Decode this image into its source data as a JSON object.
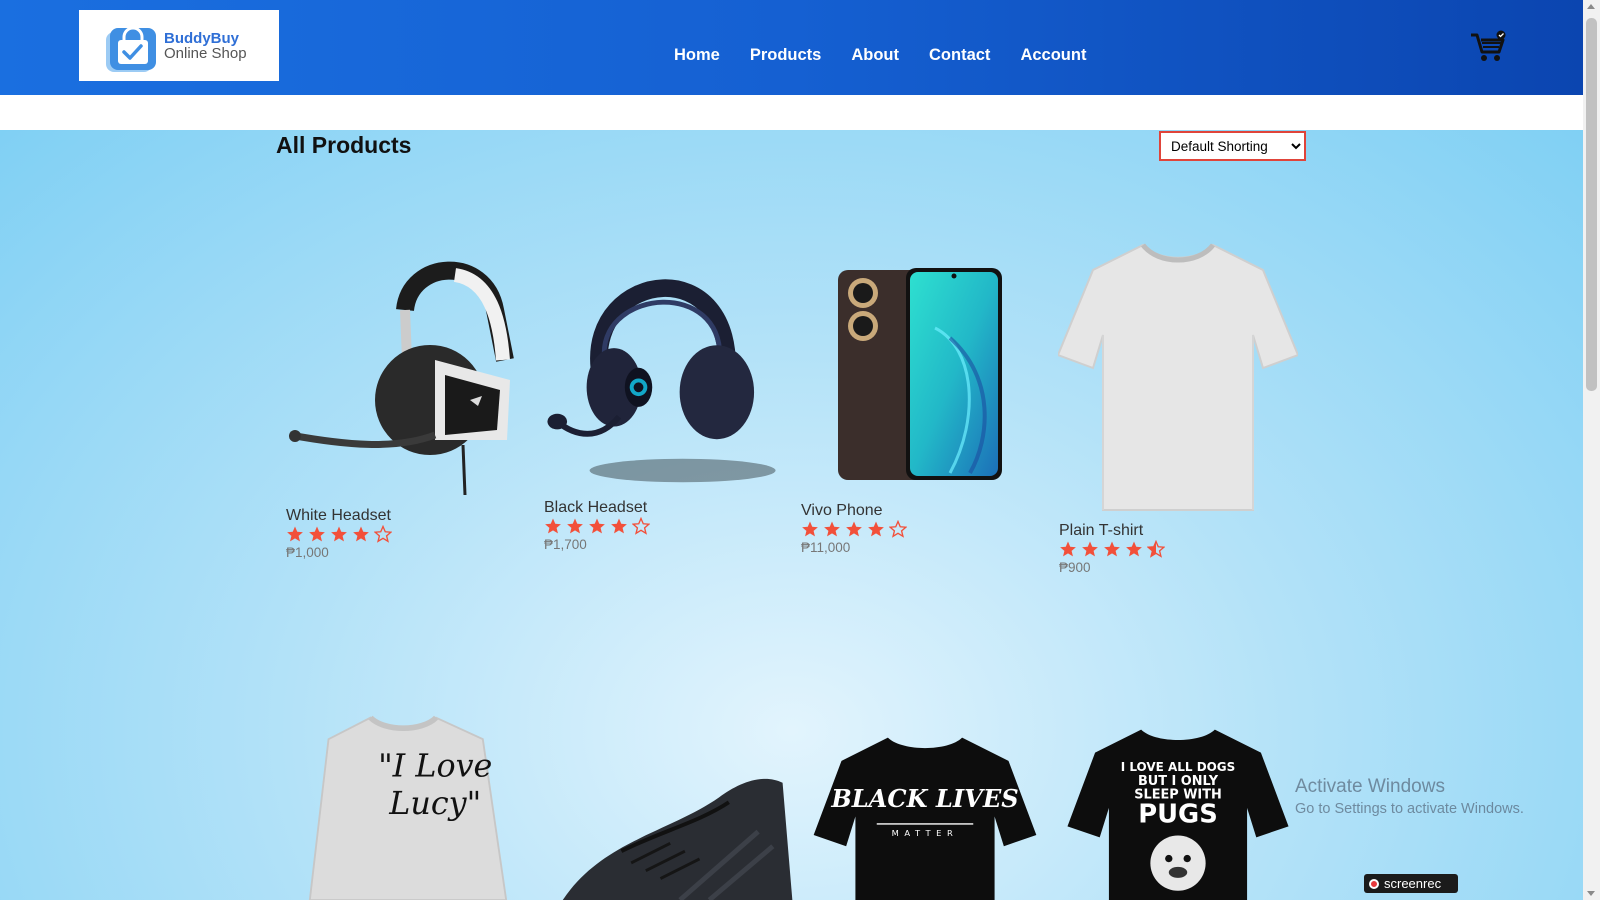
{
  "brand": {
    "name_line1": "BuddyBuy",
    "name_line2": "Online Shop",
    "primary_color": "#1a6fe0",
    "accent_color": "#e0443a",
    "star_color": "#f2503a"
  },
  "nav": {
    "items": [
      {
        "label": "Home"
      },
      {
        "label": "Products"
      },
      {
        "label": "About"
      },
      {
        "label": "Contact"
      },
      {
        "label": "Account"
      }
    ],
    "cart_icon": "cart-icon"
  },
  "main": {
    "title": "All Products",
    "sort": {
      "selected": "Default Shorting",
      "options": [
        "Default Shorting"
      ]
    }
  },
  "products": [
    {
      "name": "White Headset",
      "rating": 4,
      "price": "₱1,000",
      "icon": "white-headset-image"
    },
    {
      "name": "Black Headset",
      "rating": 4,
      "price": "₱1,700",
      "icon": "black-headset-image"
    },
    {
      "name": "Vivo Phone",
      "rating": 4,
      "price": "₱11,000",
      "icon": "phone-image"
    },
    {
      "name": "Plain T-shirt",
      "rating": 4.5,
      "price": "₱900",
      "icon": "tshirt-image"
    }
  ],
  "products_row2": [
    {
      "icon": "sweater-image",
      "print_line1": "\"I Love",
      "print_line2": "Lucy\""
    },
    {
      "icon": "shoe-image"
    },
    {
      "icon": "black-tshirt-image",
      "print_line1": "BLACK LIVES",
      "print_line2": "MATTER"
    },
    {
      "icon": "pug-tshirt-image",
      "print_line1": "I LOVE ALL DOGS",
      "print_line2": "BUT I ONLY",
      "print_line3": "SLEEP WITH",
      "print_line4": "PUGS"
    }
  ],
  "overlay": {
    "activate_title": "Activate Windows",
    "activate_sub": "Go to Settings to activate Windows.",
    "recorder": "screenrec"
  }
}
